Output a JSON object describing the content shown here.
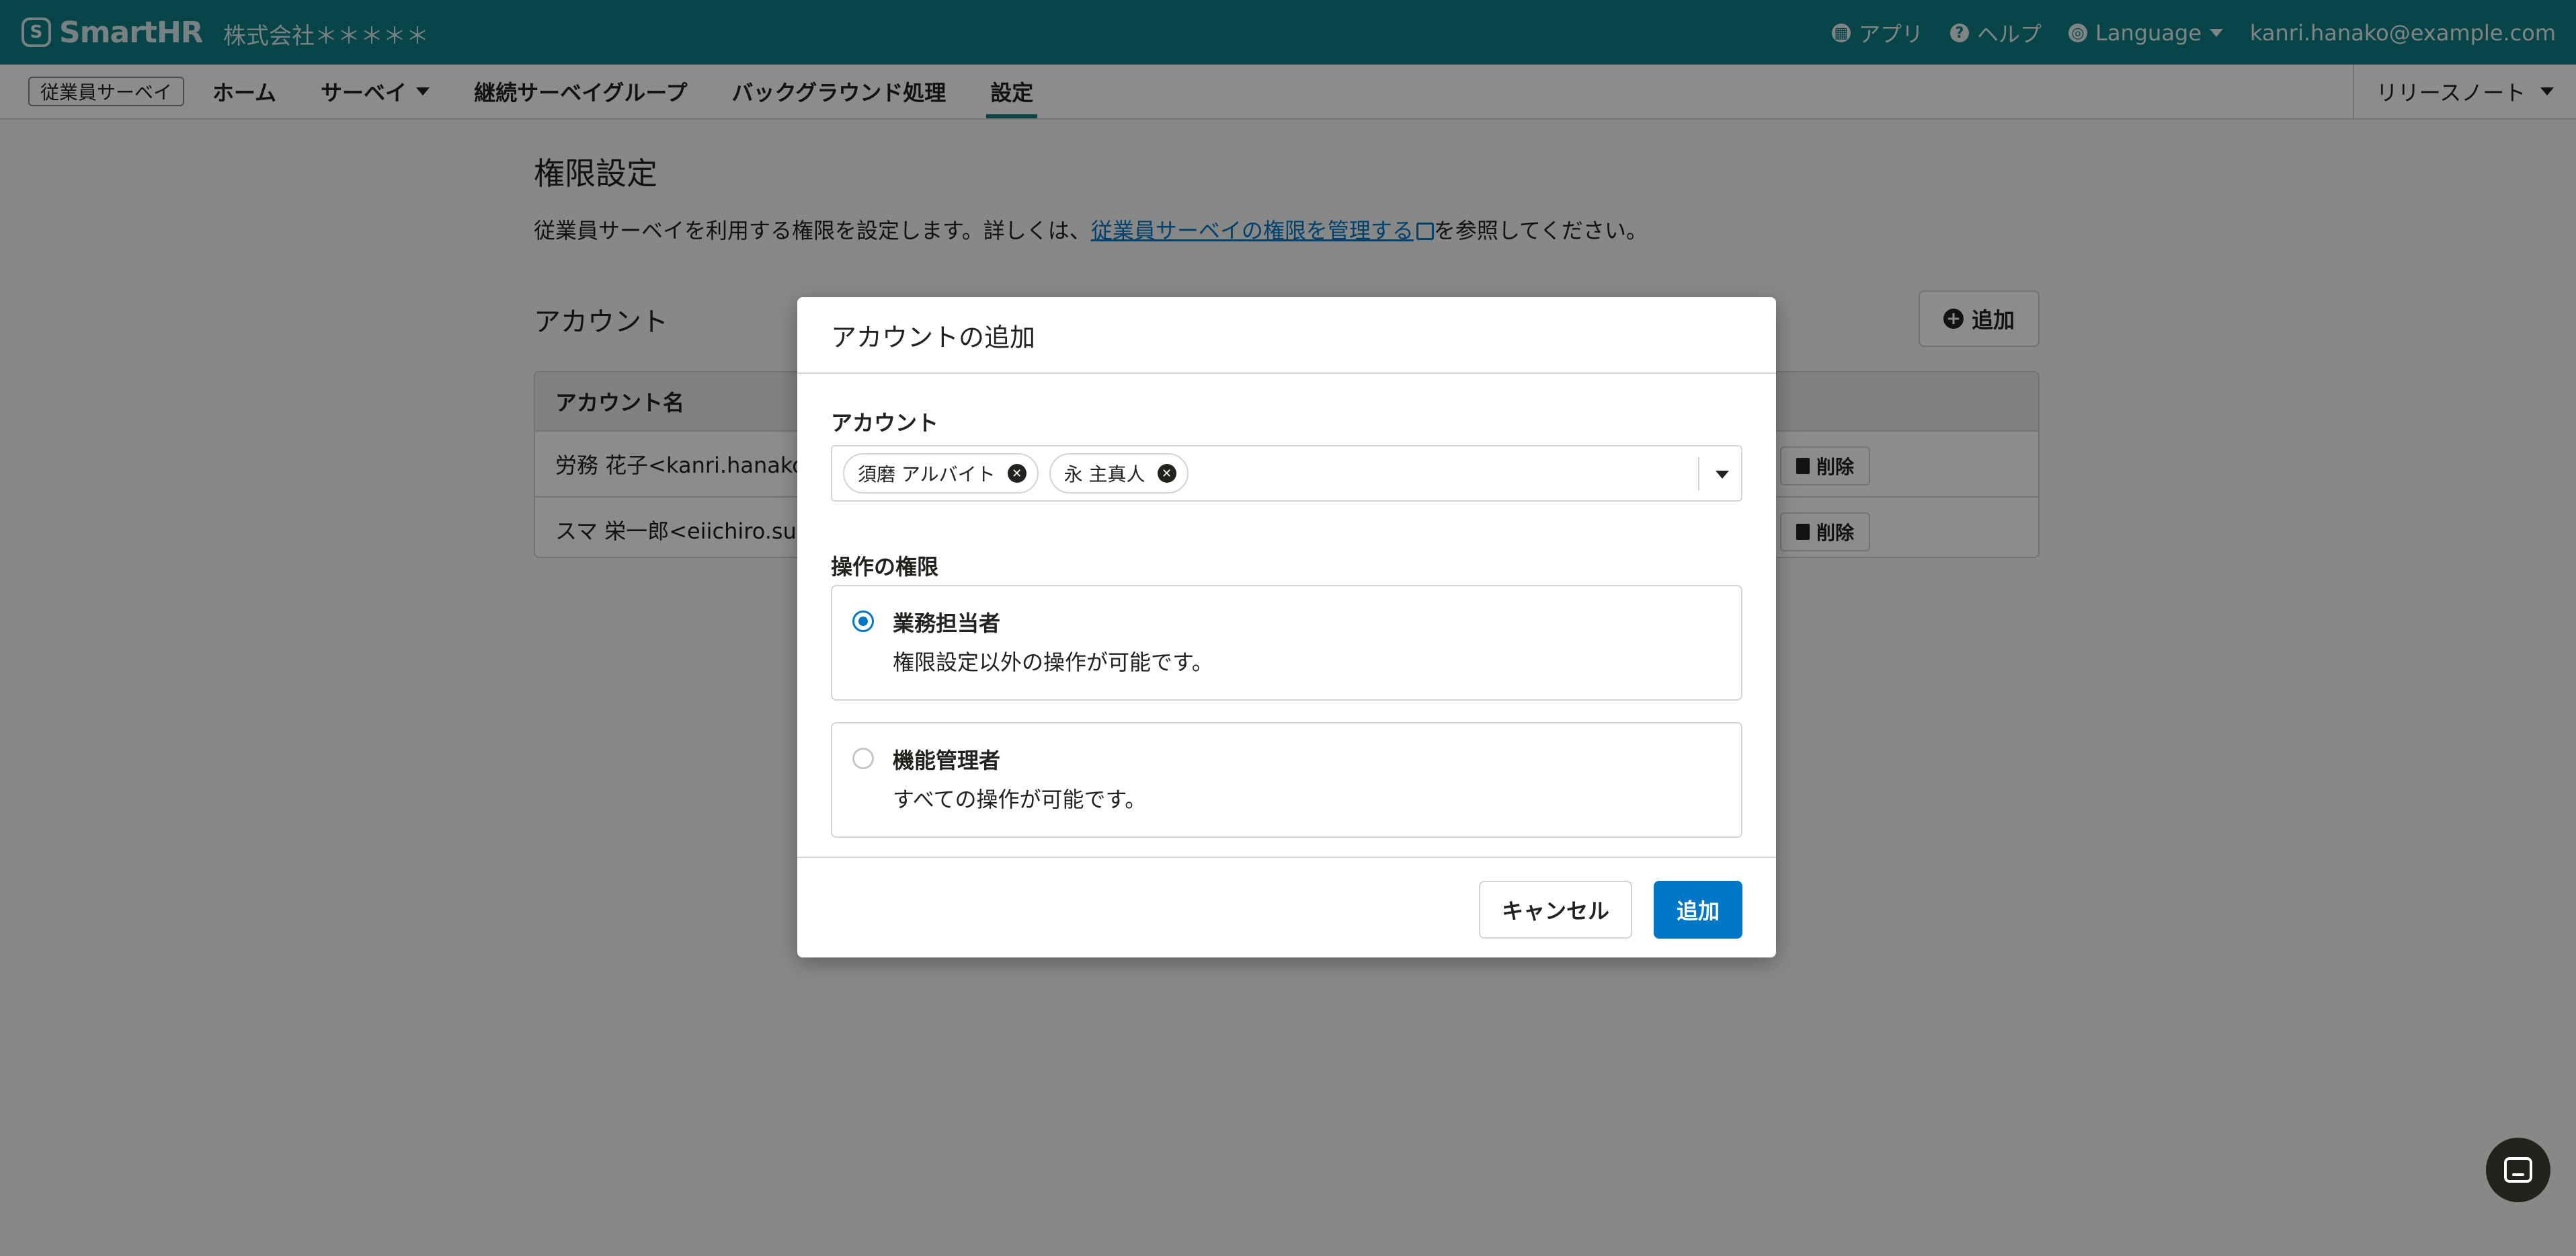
{
  "header": {
    "logo_text": "SmartHR",
    "logo_mark": "S",
    "tenant": "株式会社＊＊＊＊＊",
    "apps_label": "アプリ",
    "help_label": "ヘルプ",
    "language_label": "Language",
    "user_email": "kanri.hanako@example.com"
  },
  "nav": {
    "app_name": "従業員サーベイ",
    "items": [
      {
        "label": "ホーム"
      },
      {
        "label": "サーベイ"
      },
      {
        "label": "継続サーベイグループ"
      },
      {
        "label": "バックグラウンド処理"
      },
      {
        "label": "設定",
        "active": true
      }
    ],
    "release_notes": "リリースノート"
  },
  "page": {
    "title": "権限設定",
    "desc_before": "従業員サーベイを利用する権限を設定します。詳しくは、",
    "desc_link": "従業員サーベイの権限を管理する",
    "desc_after": "を参照してください。",
    "section_title": "アカウント",
    "add_label": "追加",
    "table": {
      "column_account": "アカウント名",
      "rows": [
        {
          "account": "労務 花子<kanri.hanako@",
          "delete_label": "削除"
        },
        {
          "account": "スマ 栄一郎<eiichiro.sum",
          "delete_label": "削除"
        }
      ]
    }
  },
  "dialog": {
    "title": "アカウントの追加",
    "account_label": "アカウント",
    "selected_accounts": [
      "須磨 アルバイト",
      "永 主真人"
    ],
    "permission_label": "操作の権限",
    "options": [
      {
        "title": "業務担当者",
        "desc": "権限設定以外の操作が可能です。",
        "selected": true
      },
      {
        "title": "機能管理者",
        "desc": "すべての操作が可能です。",
        "selected": false
      }
    ],
    "cancel_label": "キャンセル",
    "submit_label": "追加"
  },
  "colors": {
    "brand": "#0f7f85",
    "primary": "#0077c7"
  }
}
